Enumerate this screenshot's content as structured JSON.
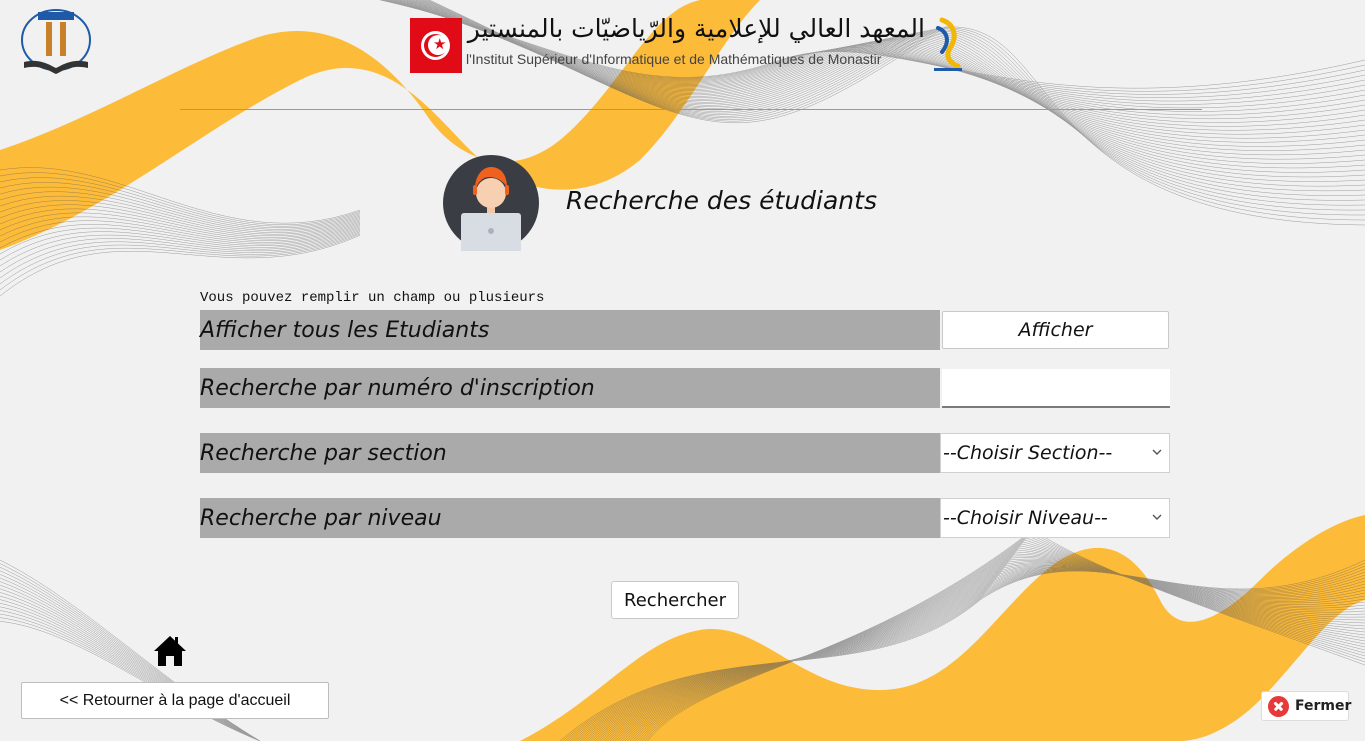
{
  "header": {
    "institute_ar": "المعهد العالي للإعلامية والرّياضيّات بالمنستير",
    "institute_fr": "l'Institut Supérieur d'Informatique et de Mathématiques de Monastir"
  },
  "page": {
    "title": "Recherche des étudiants",
    "hint": "Vous pouvez remplir un champ ou plusieurs"
  },
  "form": {
    "show_all_label": "Afficher tous les Etudiants",
    "show_all_button": "Afficher",
    "inscription_label": "Recherche par numéro d'inscription",
    "inscription_value": "",
    "section_label": "Recherche par section",
    "section_selected": "--Choisir Section--",
    "niveau_label": "Recherche par niveau",
    "niveau_selected": "--Choisir Niveau--",
    "search_button": "Rechercher"
  },
  "footer": {
    "home_button": "<< Retourner à la page d'accueil",
    "close_button": "Fermer"
  },
  "colors": {
    "accent_yellow": "#fdbb3a",
    "label_bg": "#aaaaaa",
    "close_red": "#e5393a",
    "flag_red": "#e10a17"
  }
}
